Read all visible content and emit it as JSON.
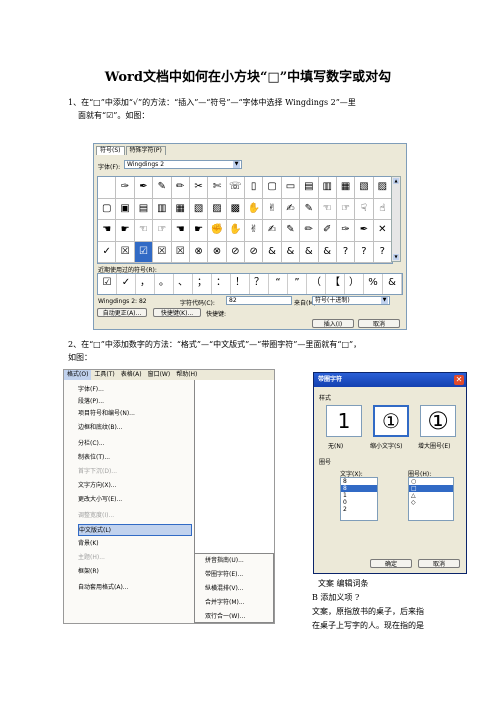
{
  "title": "Word文档中如何在小方块“□”中填写数字或对勾",
  "step1": {
    "line1": "1、在“□”中添加“√”的方法：“插入”—“符号”—“字体中选择 Wingdings 2”—里",
    "line2": "面就有“☑”。如图："
  },
  "symbol_dialog": {
    "tabs": [
      "符号(S)",
      "特殊字符(P)"
    ],
    "font_label": "字体(F):",
    "font_value": "Wingdings 2",
    "grid": [
      [
        "",
        "✑",
        "✒",
        "✎",
        "✏",
        "✂",
        "✄",
        "☏",
        "▯",
        "▢",
        "▭",
        "▤",
        "▥",
        "▦",
        "▧",
        "▨"
      ],
      [
        "▢",
        "▣",
        "▤",
        "▥",
        "▦",
        "▧",
        "▨",
        "▩",
        "✋",
        "✌",
        "✍",
        "✎",
        "☜",
        "☞",
        "☟",
        "☝"
      ],
      [
        "☚",
        "☛",
        "☜",
        "☞",
        "☚",
        "☛",
        "✊",
        "✋",
        "✌",
        "✍",
        "✎",
        "✏",
        "✐",
        "✑",
        "✒",
        "✕"
      ],
      [
        "✓",
        "☒",
        "☑",
        "☒",
        "☒",
        "⊗",
        "⊗",
        "⊘",
        "⊘",
        "&",
        "&",
        "&",
        "&",
        "?",
        "?",
        "?"
      ]
    ],
    "recent_label": "近期使用过的符号(R):",
    "recent": [
      "☑",
      "✓",
      "，",
      "。",
      "、",
      "；",
      "：",
      "！",
      "？",
      "“",
      "”",
      "（",
      "【",
      "）",
      "%",
      "&"
    ],
    "code_name": "Wingdings 2: 82",
    "code_label": "字符代码(C):",
    "code_value": "82",
    "from_label": "来自(M):",
    "from_value": "符号(十进制)",
    "autocorrect_label": "自动更正(A)...",
    "shortcut_label": "快捷键(K)...",
    "shortcut_text": "快捷键:",
    "insert_label": "插入(I)",
    "cancel_label": "取消"
  },
  "step2": {
    "line1": "2、在“□”中添加数字的方法：“格式”—“中文版式”—“带圈字符”—里面就有“□”，",
    "line2": "如图："
  },
  "format_menu": {
    "menubar": [
      "格式(O)",
      "工具(T)",
      "表格(A)",
      "窗口(W)",
      "帮助(H)"
    ],
    "items": [
      {
        "label": "字体(F)...",
        "disabled": false
      },
      {
        "label": "段落(P)...",
        "disabled": false
      },
      {
        "label": "项目符号和编号(N)...",
        "disabled": false
      },
      {
        "label": "边框和底纹(B)...",
        "disabled": false
      },
      {
        "label": "分栏(C)...",
        "disabled": false
      },
      {
        "label": "制表位(T)...",
        "disabled": false
      },
      {
        "label": "首字下沉(D)...",
        "disabled": true
      },
      {
        "label": "文字方向(X)...",
        "disabled": false
      },
      {
        "label": "更改大小写(E)...",
        "disabled": false
      },
      {
        "label": "调整宽度(I)...",
        "disabled": true
      },
      {
        "label": "中文版式(L)",
        "disabled": false
      },
      {
        "label": "背景(K)",
        "disabled": false
      },
      {
        "label": "主题(H)...",
        "disabled": true
      },
      {
        "label": "框架(R)",
        "disabled": false
      },
      {
        "label": "自动套用格式(A)...",
        "disabled": false
      }
    ],
    "submenu": [
      "拼音指南(U)...",
      "带圈字符(E)...",
      "纵横混排(V)...",
      "合并字符(M)...",
      "双行合一(W)..."
    ]
  },
  "enclose_dialog": {
    "title": "带圈字符",
    "style_label": "样式",
    "styles": [
      "无(N)",
      "缩小文字(S)",
      "增大圈号(E)"
    ],
    "style_glyphs": [
      "1",
      "①",
      "①"
    ],
    "circle_label": "圈号",
    "text_label": "文字(X):",
    "text_items": [
      "8",
      "8",
      "1",
      "0",
      "2"
    ],
    "ring_label": "圈号(H):",
    "ring_items": [
      "○",
      "□",
      "△",
      "◇"
    ],
    "ok_label": "确定",
    "cancel_label": "取消"
  },
  "side_text": {
    "line1": "文案 编辑词条",
    "line2": "B 添加义项 ?",
    "line3": "文案，原指放书的桌子，后来指",
    "line4": "在桌子上写字的人。现在指的是"
  }
}
